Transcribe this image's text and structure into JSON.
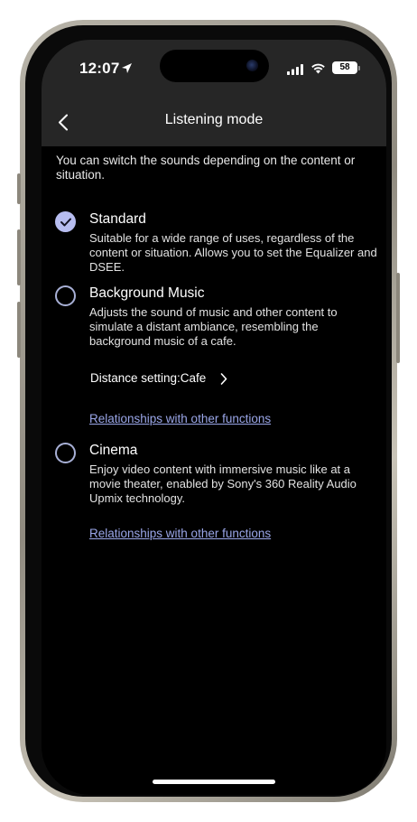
{
  "status_bar": {
    "time": "12:07",
    "battery": "58"
  },
  "nav": {
    "title": "Listening mode",
    "back_icon": "chevron-left-icon"
  },
  "intro": "You can switch the sounds depending on the content or situation.",
  "options": [
    {
      "title": "Standard",
      "description": "Suitable for a wide range of uses, regardless of the content or situation. Allows you to set the Equalizer and DSEE.",
      "selected": true
    },
    {
      "title": "Background Music",
      "description": "Adjusts the sound of music and other content to simulate a distant ambiance, resembling the background music of a cafe.",
      "selected": false,
      "distance_setting": "Distance setting:Cafe",
      "link": "Relationships with other functions"
    },
    {
      "title": "Cinema",
      "description": "Enjoy video content with immersive music like at a movie theater, enabled by Sony's 360 Reality Audio Upmix technology.",
      "selected": false,
      "link": "Relationships with other functions"
    }
  ],
  "colors": {
    "accent": "#b7bdf0",
    "link": "#9aa6e8",
    "bar_background": "#262626",
    "screen_background": "#000000"
  }
}
